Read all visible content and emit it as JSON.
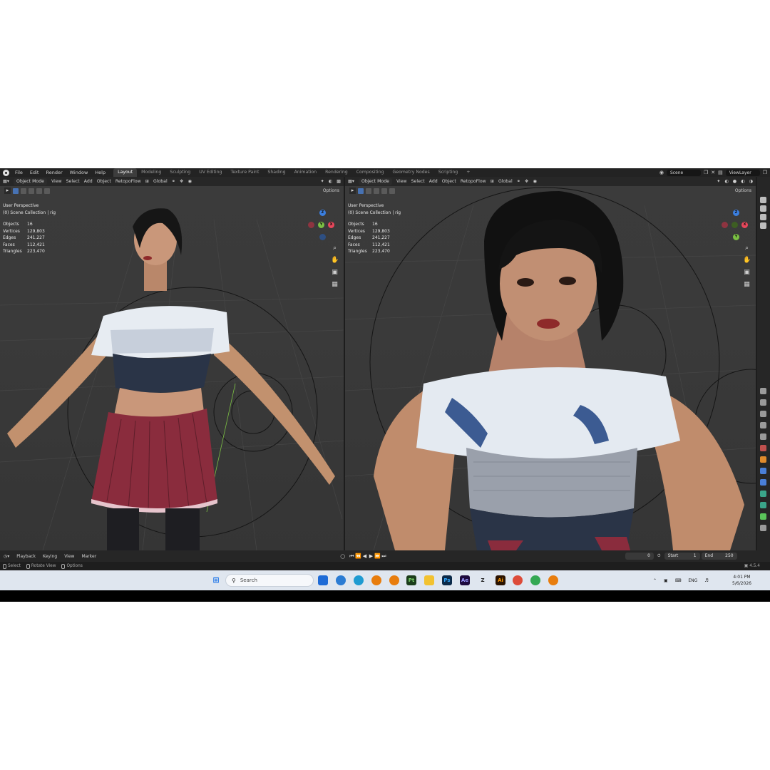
{
  "topbar": {
    "menus": [
      "File",
      "Edit",
      "Render",
      "Window",
      "Help"
    ],
    "workspaces": [
      "Layout",
      "Modeling",
      "Sculpting",
      "UV Editing",
      "Texture Paint",
      "Shading",
      "Animation",
      "Rendering",
      "Compositing",
      "Geometry Nodes",
      "Scripting"
    ],
    "active_workspace": "Layout",
    "add_tab": "+",
    "scene": "Scene",
    "view_layer": "ViewLayer"
  },
  "viewport_header": {
    "mode": "Object Mode",
    "menus": [
      "View",
      "Select",
      "Add",
      "Object"
    ],
    "addon": "RetopoFlow",
    "orientation": "Global",
    "options": "Options"
  },
  "viewport_left": {
    "perspective": "User Perspective",
    "collection": "(0) Scene Collection | rig",
    "stats": [
      {
        "label": "Objects",
        "value": "16"
      },
      {
        "label": "Vertices",
        "value": "129,803"
      },
      {
        "label": "Edges",
        "value": "241,227"
      },
      {
        "label": "Faces",
        "value": "112,421"
      },
      {
        "label": "Triangles",
        "value": "223,470"
      }
    ]
  },
  "viewport_right": {
    "perspective": "User Perspective",
    "collection": "(0) Scene Collection | rig",
    "stats": [
      {
        "label": "Objects",
        "value": "16"
      },
      {
        "label": "Vertices",
        "value": "129,803"
      },
      {
        "label": "Edges",
        "value": "241,227"
      },
      {
        "label": "Faces",
        "value": "112,421"
      },
      {
        "label": "Triangles",
        "value": "223,470"
      }
    ]
  },
  "gizmo": {
    "z": "Z",
    "x": "X",
    "y": "Y"
  },
  "timeline": {
    "menus": [
      "Playback",
      "Keying",
      "View",
      "Marker"
    ],
    "current_frame": "0",
    "start_label": "Start",
    "start": "1",
    "end_label": "End",
    "end": "250"
  },
  "statusbar": {
    "select": "Select",
    "rotate": "Rotate View",
    "options": "Options",
    "version": "4.5.4"
  },
  "taskbar": {
    "search_placeholder": "Search",
    "language": "ENG",
    "time": "4:01 PM",
    "date": "5/6/2026"
  },
  "colors": {
    "accent": "#4772b3",
    "axis_x": "#e8475b",
    "axis_y": "#7bc043",
    "axis_z": "#3b7fe0",
    "skirt": "#8a2c3d",
    "top_dark": "#2a3447"
  }
}
